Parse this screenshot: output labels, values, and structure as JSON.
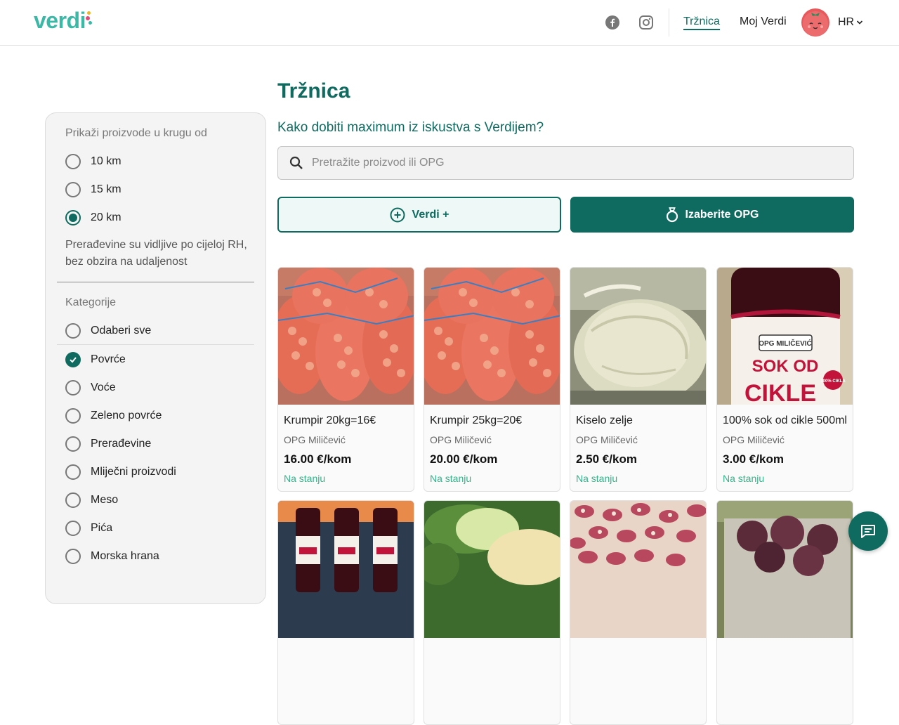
{
  "header": {
    "logo": "verdi",
    "nav_active": "Tržnica",
    "nav_moj": "Moj Verdi",
    "lang": "HR",
    "icons": {
      "facebook": "facebook-icon",
      "instagram": "instagram-icon",
      "lang_chevron": "chevron-down-icon"
    }
  },
  "page": {
    "title": "Tržnica",
    "subtitle": "Kako dobiti maximum iz iskustva s Verdijem?"
  },
  "search": {
    "placeholder": "Pretražite proizvod ili OPG",
    "value": ""
  },
  "buttons": {
    "verdi_plus": "Verdi +",
    "choose_opg": "Izaberite OPG"
  },
  "sidebar": {
    "distance_label": "Prikaži proizvode u krugu od",
    "distances": [
      {
        "label": "10 km",
        "selected": false
      },
      {
        "label": "15 km",
        "selected": false
      },
      {
        "label": "20 km",
        "selected": true
      }
    ],
    "note": "Prerađevine su vidljive po cijeloj RH, bez obzira na udaljenost",
    "categories_label": "Kategorije",
    "categories": [
      {
        "label": "Odaberi sve",
        "selected": false
      },
      {
        "label": "Povrće",
        "selected": true
      },
      {
        "label": "Voće",
        "selected": false
      },
      {
        "label": "Zeleno povrće",
        "selected": false
      },
      {
        "label": "Prerađevine",
        "selected": false
      },
      {
        "label": "Mliječni proizvodi",
        "selected": false
      },
      {
        "label": "Meso",
        "selected": false
      },
      {
        "label": "Pića",
        "selected": false
      },
      {
        "label": "Morska hrana",
        "selected": false
      }
    ]
  },
  "products": [
    {
      "name": "Krumpir 20kg=16€",
      "opg": "OPG Miličević",
      "price": "16.00 €/kom",
      "stock": "Na stanju"
    },
    {
      "name": "Krumpir 25kg=20€",
      "opg": "OPG Miličević",
      "price": "20.00 €/kom",
      "stock": "Na stanju"
    },
    {
      "name": "Kiselo zelje",
      "opg": "OPG Miličević",
      "price": "2.50 €/kom",
      "stock": "Na stanju"
    },
    {
      "name": "100% sok od cikle 500ml",
      "opg": "OPG Miličević",
      "price": "3.00 €/kom",
      "stock": "Na stanju"
    }
  ],
  "product_images": {
    "label_brand": "OPG MILIČEVIĆ",
    "label_line1": "SOK OD",
    "label_line2": "CIKLE",
    "label_badge": "100% CIKLA"
  },
  "colors": {
    "brand": "#0f6b5f",
    "logo": "#3cb8a6",
    "in_stock": "#36b28a"
  }
}
